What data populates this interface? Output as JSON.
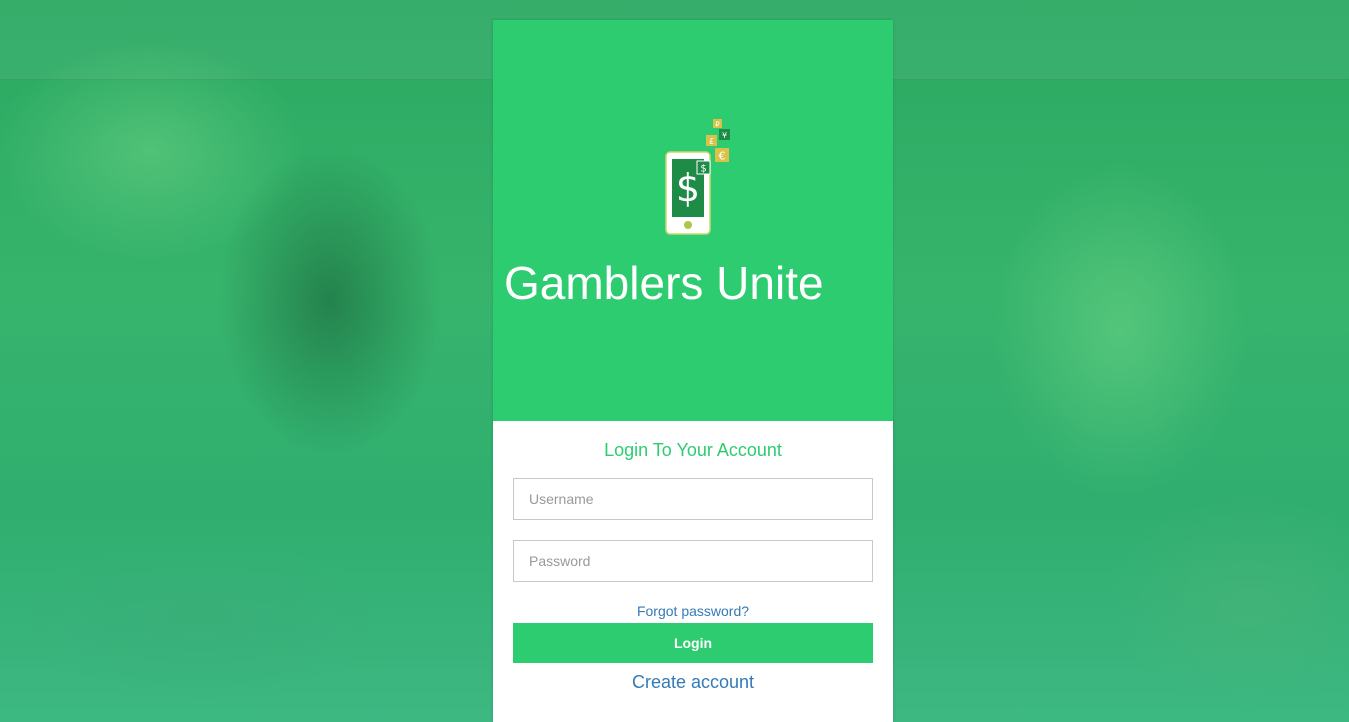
{
  "app": {
    "title": "Gamblers Unite"
  },
  "theme": {
    "accent": "#2ecc71",
    "link": "#337ab7",
    "background_tint": "#2aa861"
  },
  "logo": {
    "icon": "phone-dollar-icon",
    "symbols": {
      "dollar": "$",
      "small_dollar": "$",
      "euro": "€",
      "pound": "£",
      "yen": "¥",
      "ruble": "₽"
    }
  },
  "login": {
    "heading": "Login To Your Account",
    "username": {
      "placeholder": "Username",
      "value": ""
    },
    "password": {
      "placeholder": "Password",
      "value": ""
    },
    "forgot_label": "Forgot password?",
    "submit_label": "Login",
    "create_label": "Create account"
  }
}
